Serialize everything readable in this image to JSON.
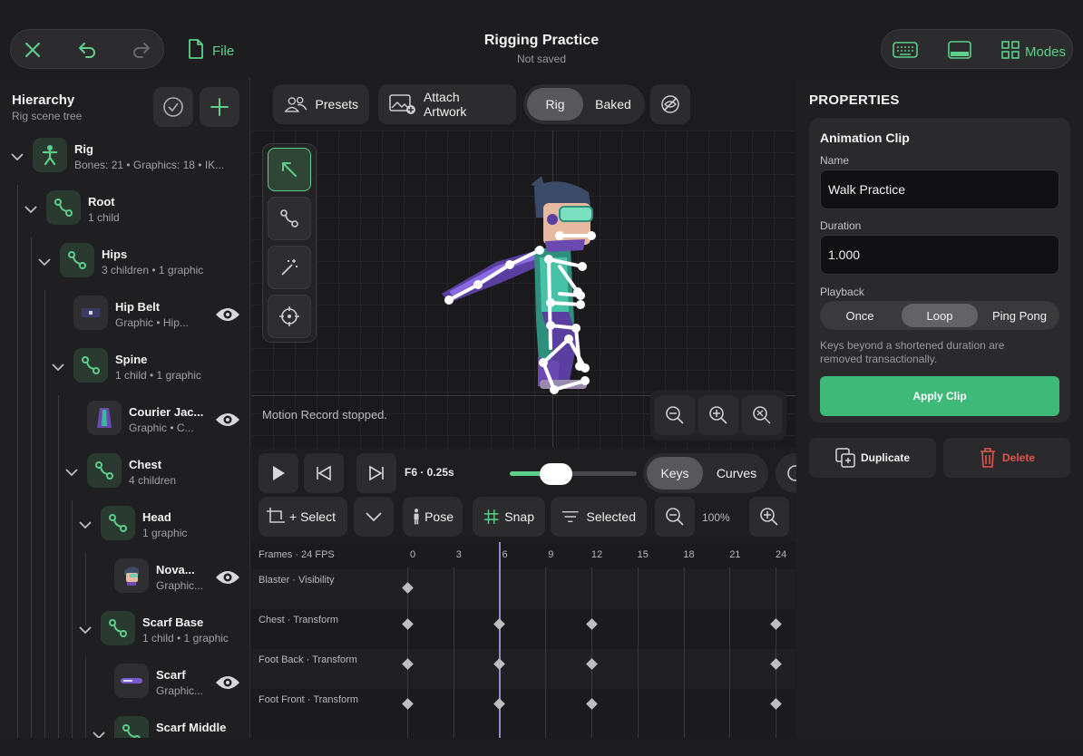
{
  "header": {
    "title": "Rigging Practice",
    "status": "Not saved",
    "file_label": "File",
    "modes_label": "Modes"
  },
  "hierarchy": {
    "title": "Hierarchy",
    "subtitle": "Rig scene tree",
    "nodes": [
      {
        "name": "Rig",
        "meta": "Bones: 21  •  Graphics: 18  •  IK..."
      },
      {
        "name": "Root",
        "meta": "1 child"
      },
      {
        "name": "Hips",
        "meta": "3 children  •  1 graphic"
      },
      {
        "name": "Hip Belt",
        "meta": "Graphic  •  Hip..."
      },
      {
        "name": "Spine",
        "meta": "1 child  •  1 graphic"
      },
      {
        "name": "Courier Jac...",
        "meta": "Graphic  •  C..."
      },
      {
        "name": "Chest",
        "meta": "4 children"
      },
      {
        "name": "Head",
        "meta": "1 graphic"
      },
      {
        "name": "Nova...",
        "meta": "Graphic..."
      },
      {
        "name": "Scarf Base",
        "meta": "1 child  •  1 graphic"
      },
      {
        "name": "Scarf",
        "meta": "Graphic..."
      },
      {
        "name": "Scarf Middle",
        "meta": ""
      }
    ]
  },
  "toolbar": {
    "presets": "Presets",
    "attach": "Attach Artwork",
    "rig": "Rig",
    "baked": "Baked"
  },
  "canvas": {
    "status": "Motion Record stopped."
  },
  "playback": {
    "frame_label": "F6 · 0.25s",
    "scrub_fraction": 0.32,
    "keys": "Keys",
    "curves": "Curves",
    "select": "+ Select",
    "pose": "Pose",
    "snap": "Snap",
    "selected": "Selected",
    "zoom": "100%"
  },
  "timeline": {
    "header": "Frames · 24 FPS",
    "ticks": [
      "0",
      "3",
      "6",
      "9",
      "12",
      "15",
      "18",
      "21",
      "24"
    ],
    "playhead_frame": 6,
    "tracks": [
      {
        "name": "Blaster · Visibility",
        "keys": [
          0
        ]
      },
      {
        "name": "Chest · Transform",
        "keys": [
          0,
          6,
          12,
          24
        ]
      },
      {
        "name": "Foot Back · Transform",
        "keys": [
          0,
          6,
          12,
          24
        ]
      },
      {
        "name": "Foot Front · Transform",
        "keys": [
          0,
          6,
          12,
          24
        ]
      }
    ]
  },
  "properties": {
    "title": "PROPERTIES",
    "section": "Animation Clip",
    "name_label": "Name",
    "name_value": "Walk Practice",
    "duration_label": "Duration",
    "duration_value": "1.000",
    "playback_label": "Playback",
    "playback_options": [
      "Once",
      "Loop",
      "Ping Pong"
    ],
    "playback_selected": "Loop",
    "note": "Keys beyond a shortened duration are removed transactionally.",
    "apply": "Apply Clip",
    "duplicate": "Duplicate",
    "delete": "Delete",
    "accent": "#5cd08a",
    "danger": "#e5534b"
  }
}
